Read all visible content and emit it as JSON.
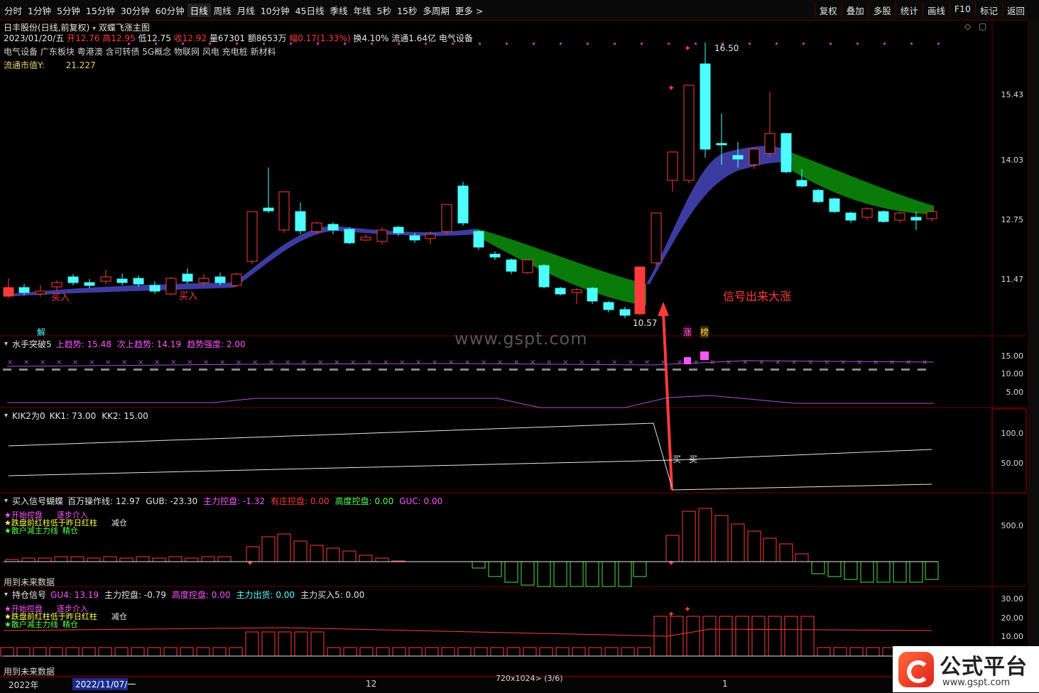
{
  "toolbar": {
    "periods": [
      "分时",
      "1分钟",
      "5分钟",
      "15分钟",
      "30分钟",
      "60分钟",
      "日线",
      "周线",
      "月线",
      "10分钟",
      "45日线",
      "季线",
      "年线",
      "5秒",
      "15秒",
      "多周期",
      "更多 >"
    ],
    "active_period": "日线",
    "right_buttons": [
      "复权",
      "叠加",
      "多股",
      "统计",
      "画线",
      "F10",
      "标记",
      "返回"
    ]
  },
  "stock": {
    "name_line": "日丰股份(日线,前复权)",
    "indicator_name": "双蝶飞涨主图",
    "date": "2023/01/20/五",
    "open_label": "开",
    "open": "12.76",
    "high_label": "高",
    "high": "12.95",
    "low_label": "低",
    "low": "12.75",
    "close_label": "收",
    "close": "12.92",
    "volume_label": "量",
    "volume": "67301",
    "amount_label": "额",
    "amount": "8653万",
    "change_label": "幅",
    "change": "0.17(1.33%)",
    "turnover": "换4.10%",
    "float_share": "流通1.64亿",
    "industry": "电气设备",
    "concepts": "电气设备 广东板块 粤港澳 含可转债 5G概念 物联网 风电 充电桩 新材料",
    "float_mv_label": "流通市值Y:",
    "float_mv": "21.227"
  },
  "main_chart": {
    "price_labels": [
      "15.43",
      "14.03",
      "12.75",
      "11.47"
    ],
    "high_annotation": "16.50",
    "low_annotation": "10.57",
    "buy_label": "买入",
    "signal_text": "信号出来大涨",
    "jie_label": "解",
    "zhang_label": "涨",
    "bang_label": "榜",
    "colors": {
      "up": "#ff3b3b",
      "down": "#4dffff",
      "band_up": "#3c3ca0",
      "band_down": "#0a7a0a",
      "signal": "#ff3b3b"
    }
  },
  "panel1": {
    "title": "水手突破5",
    "items": [
      {
        "label": "上趋势:",
        "value": "15.48",
        "color": "#ff55ff"
      },
      {
        "label": "次上趋势:",
        "value": "14.19",
        "color": "#ff55ff"
      },
      {
        "label": "趋势强度:",
        "value": "2.00",
        "color": "#ff55ff"
      }
    ],
    "y_labels": [
      "15.00",
      "10.00",
      "5.00"
    ]
  },
  "panel2": {
    "title": "KIK2为0",
    "items": [
      {
        "label": "KK1:",
        "value": "73.00",
        "color": "#e6e6e6"
      },
      {
        "label": "KK2:",
        "value": "15.00",
        "color": "#e6e6e6"
      }
    ],
    "y_labels": [
      "100.0",
      "50.00"
    ],
    "buy_label": "买"
  },
  "panel3": {
    "title": "买入信号蝴蝶",
    "items": [
      {
        "label": "百万操作线:",
        "value": "12.97",
        "color": "#e6e6e6"
      },
      {
        "label": "GUB:",
        "value": "-23.30",
        "color": "#e6e6e6"
      },
      {
        "label": "主力控盘:",
        "value": "-1.32",
        "color": "#ff55ff"
      },
      {
        "label": "有庄控盘:",
        "value": "0.00",
        "color": "#ff3b3b"
      },
      {
        "label": "高度控盘:",
        "value": "0.00",
        "color": "#55ff55"
      },
      {
        "label": "GUC:",
        "value": "0.00",
        "color": "#ff55ff"
      }
    ],
    "legend": [
      "开始控盘",
      "逐步介入",
      "跌盘前红柱低于昨日红柱",
      "减仓",
      "散户减主力线",
      "精仓"
    ],
    "y_labels": [
      "500.0"
    ],
    "footer": "用到未来数据"
  },
  "panel4": {
    "title": "持仓信号",
    "items": [
      {
        "label": "GU4:",
        "value": "13.19",
        "color": "#ff55ff"
      },
      {
        "label": "主力控盘:",
        "value": "-0.79",
        "color": "#e6e6e6"
      },
      {
        "label": "高度控盘:",
        "value": "0.00",
        "color": "#ff55ff"
      },
      {
        "label": "主力出货:",
        "value": "0.00",
        "color": "#55ffff"
      },
      {
        "label": "主力买入5:",
        "value": "0.00",
        "color": "#e6e6e6"
      }
    ],
    "legend": [
      "开始控盘",
      "逐步介入",
      "跌盘前红柱低于昨日红柱",
      "减仓",
      "散户减主力线",
      "精仓"
    ],
    "y_labels": [
      "30.00",
      "20.00",
      "10.00"
    ],
    "footer": "用到未来数据"
  },
  "status": {
    "year": "2022年",
    "date_range": "2022/11/07/一",
    "month": "12",
    "tick_1": "1",
    "zoom": "720x1024> (3/6)"
  },
  "watermark": "www.gspt.com",
  "logo": {
    "title": "公式平台",
    "url": "www.gspt.com"
  }
}
